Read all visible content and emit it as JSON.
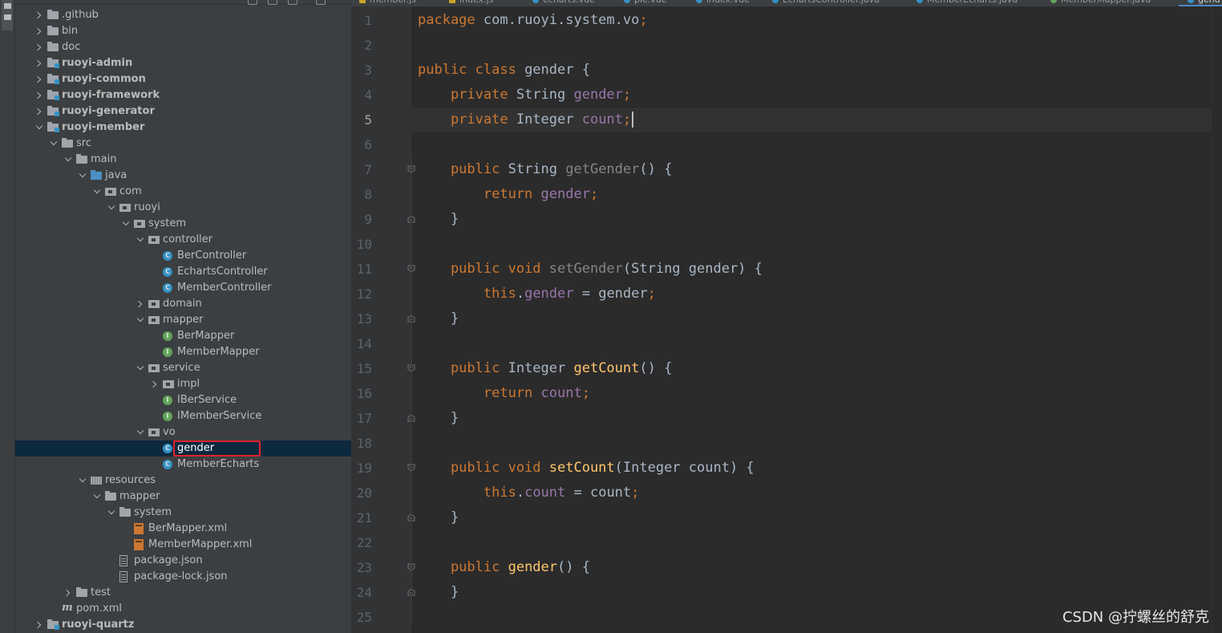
{
  "tree": [
    {
      "label": ".github",
      "depth": 1,
      "icon": "folder",
      "arrow": "collapsed",
      "bold": false
    },
    {
      "label": "bin",
      "depth": 1,
      "icon": "folder",
      "arrow": "collapsed",
      "bold": false
    },
    {
      "label": "doc",
      "depth": 1,
      "icon": "folder",
      "arrow": "collapsed",
      "bold": false
    },
    {
      "label": "ruoyi-admin",
      "depth": 1,
      "icon": "module",
      "arrow": "collapsed",
      "bold": true
    },
    {
      "label": "ruoyi-common",
      "depth": 1,
      "icon": "module",
      "arrow": "collapsed",
      "bold": true
    },
    {
      "label": "ruoyi-framework",
      "depth": 1,
      "icon": "module",
      "arrow": "collapsed",
      "bold": true
    },
    {
      "label": "ruoyi-generator",
      "depth": 1,
      "icon": "module",
      "arrow": "collapsed",
      "bold": true
    },
    {
      "label": "ruoyi-member",
      "depth": 1,
      "icon": "module",
      "arrow": "expanded",
      "bold": true
    },
    {
      "label": "src",
      "depth": 2,
      "icon": "folder",
      "arrow": "expanded",
      "bold": false
    },
    {
      "label": "main",
      "depth": 3,
      "icon": "folder",
      "arrow": "expanded",
      "bold": false
    },
    {
      "label": "java",
      "depth": 4,
      "icon": "srcfolder",
      "arrow": "expanded",
      "bold": false
    },
    {
      "label": "com",
      "depth": 5,
      "icon": "package",
      "arrow": "expanded",
      "bold": false
    },
    {
      "label": "ruoyi",
      "depth": 6,
      "icon": "package",
      "arrow": "expanded",
      "bold": false
    },
    {
      "label": "system",
      "depth": 7,
      "icon": "package",
      "arrow": "expanded",
      "bold": false
    },
    {
      "label": "controller",
      "depth": 8,
      "icon": "package",
      "arrow": "expanded",
      "bold": false
    },
    {
      "label": "BerController",
      "depth": 9,
      "icon": "class",
      "arrow": "none",
      "bold": false
    },
    {
      "label": "EchartsController",
      "depth": 9,
      "icon": "class",
      "arrow": "none",
      "bold": false
    },
    {
      "label": "MemberController",
      "depth": 9,
      "icon": "class",
      "arrow": "none",
      "bold": false
    },
    {
      "label": "domain",
      "depth": 8,
      "icon": "package",
      "arrow": "collapsed",
      "bold": false
    },
    {
      "label": "mapper",
      "depth": 8,
      "icon": "package",
      "arrow": "expanded",
      "bold": false
    },
    {
      "label": "BerMapper",
      "depth": 9,
      "icon": "iface",
      "arrow": "none",
      "bold": false
    },
    {
      "label": "MemberMapper",
      "depth": 9,
      "icon": "iface",
      "arrow": "none",
      "bold": false
    },
    {
      "label": "service",
      "depth": 8,
      "icon": "package",
      "arrow": "expanded",
      "bold": false
    },
    {
      "label": "impl",
      "depth": 9,
      "icon": "package",
      "arrow": "collapsed",
      "bold": false
    },
    {
      "label": "IBerService",
      "depth": 9,
      "icon": "iface",
      "arrow": "none",
      "bold": false
    },
    {
      "label": "IMemberService",
      "depth": 9,
      "icon": "iface",
      "arrow": "none",
      "bold": false
    },
    {
      "label": "vo",
      "depth": 8,
      "icon": "package",
      "arrow": "expanded",
      "bold": false
    },
    {
      "label": "gender",
      "depth": 9,
      "icon": "class",
      "arrow": "none",
      "bold": false,
      "selected": true
    },
    {
      "label": "MemberEcharts",
      "depth": 9,
      "icon": "class",
      "arrow": "none",
      "bold": false
    },
    {
      "label": "resources",
      "depth": 4,
      "icon": "resfolder",
      "arrow": "expanded",
      "bold": false
    },
    {
      "label": "mapper",
      "depth": 5,
      "icon": "folder",
      "arrow": "expanded",
      "bold": false
    },
    {
      "label": "system",
      "depth": 6,
      "icon": "folder",
      "arrow": "expanded",
      "bold": false
    },
    {
      "label": "BerMapper.xml",
      "depth": 7,
      "icon": "xml",
      "arrow": "none",
      "bold": false
    },
    {
      "label": "MemberMapper.xml",
      "depth": 7,
      "icon": "xml",
      "arrow": "none",
      "bold": false
    },
    {
      "label": "package.json",
      "depth": 6,
      "icon": "json",
      "arrow": "none",
      "bold": false
    },
    {
      "label": "package-lock.json",
      "depth": 6,
      "icon": "json",
      "arrow": "none",
      "bold": false
    },
    {
      "label": "test",
      "depth": 3,
      "icon": "folder",
      "arrow": "collapsed",
      "bold": false
    },
    {
      "label": "pom.xml",
      "depth": 2,
      "icon": "maven",
      "arrow": "none",
      "bold": false
    },
    {
      "label": "ruoyi-quartz",
      "depth": 1,
      "icon": "module",
      "arrow": "collapsed",
      "bold": true
    }
  ],
  "editor_tabs": [
    {
      "label": "member.js",
      "icon": "js",
      "active": false
    },
    {
      "label": "index.js",
      "icon": "js",
      "active": false
    },
    {
      "label": "echarts.vue",
      "icon": "class",
      "active": false
    },
    {
      "label": "pie.vue",
      "icon": "class",
      "active": false
    },
    {
      "label": "index.vue",
      "icon": "class",
      "active": false
    },
    {
      "label": "EchartsController.java",
      "icon": "class",
      "active": false
    },
    {
      "label": "MemberEcharts.java",
      "icon": "class",
      "active": false
    },
    {
      "label": "MemberMapper.java",
      "icon": "i",
      "active": false
    },
    {
      "label": "gend",
      "icon": "class",
      "active": true
    }
  ],
  "current_line": 5,
  "code_lines": [
    [
      {
        "t": "package ",
        "c": "kw"
      },
      {
        "t": "com.ruoyi.system.vo",
        "c": ""
      },
      {
        "t": ";",
        "c": "kw"
      }
    ],
    [],
    [
      {
        "t": "public class ",
        "c": "kw"
      },
      {
        "t": "gender {",
        "c": ""
      }
    ],
    [
      {
        "t": "    private ",
        "c": "kw"
      },
      {
        "t": "String ",
        "c": ""
      },
      {
        "t": "gender",
        "c": "field"
      },
      {
        "t": ";",
        "c": "kw"
      }
    ],
    [
      {
        "t": "    private ",
        "c": "kw"
      },
      {
        "t": "Integer ",
        "c": ""
      },
      {
        "t": "count",
        "c": "field"
      },
      {
        "t": ";",
        "c": "kw"
      }
    ],
    [],
    [
      {
        "t": "    public ",
        "c": "kw"
      },
      {
        "t": "String ",
        "c": ""
      },
      {
        "t": "getGender",
        "c": "munused"
      },
      {
        "t": "() {",
        "c": ""
      }
    ],
    [
      {
        "t": "        return ",
        "c": "kw"
      },
      {
        "t": "gender",
        "c": "field"
      },
      {
        "t": ";",
        "c": "kw"
      }
    ],
    [
      {
        "t": "    }",
        "c": ""
      }
    ],
    [],
    [
      {
        "t": "    public void ",
        "c": "kw"
      },
      {
        "t": "setGender",
        "c": "munused"
      },
      {
        "t": "(String gender) {",
        "c": ""
      }
    ],
    [
      {
        "t": "        this",
        "c": "kw"
      },
      {
        "t": ".",
        "c": ""
      },
      {
        "t": "gender",
        "c": "field"
      },
      {
        "t": " = gender",
        "c": ""
      },
      {
        "t": ";",
        "c": "kw"
      }
    ],
    [
      {
        "t": "    }",
        "c": ""
      }
    ],
    [],
    [
      {
        "t": "    public ",
        "c": "kw"
      },
      {
        "t": "Integer ",
        "c": ""
      },
      {
        "t": "getCount",
        "c": "mdecl"
      },
      {
        "t": "() {",
        "c": ""
      }
    ],
    [
      {
        "t": "        return ",
        "c": "kw"
      },
      {
        "t": "count",
        "c": "field"
      },
      {
        "t": ";",
        "c": "kw"
      }
    ],
    [
      {
        "t": "    }",
        "c": ""
      }
    ],
    [],
    [
      {
        "t": "    public void ",
        "c": "kw"
      },
      {
        "t": "setCount",
        "c": "mdecl"
      },
      {
        "t": "(Integer count) {",
        "c": ""
      }
    ],
    [
      {
        "t": "        this",
        "c": "kw"
      },
      {
        "t": ".",
        "c": ""
      },
      {
        "t": "count",
        "c": "field"
      },
      {
        "t": " = count",
        "c": ""
      },
      {
        "t": ";",
        "c": "kw"
      }
    ],
    [
      {
        "t": "    }",
        "c": ""
      }
    ],
    [],
    [
      {
        "t": "    public ",
        "c": "kw"
      },
      {
        "t": "gender",
        "c": "mdecl"
      },
      {
        "t": "() {",
        "c": ""
      }
    ],
    [
      {
        "t": "    }",
        "c": ""
      }
    ],
    []
  ],
  "fold_markers": [
    {
      "line": 7,
      "kind": "open"
    },
    {
      "line": 9,
      "kind": "close"
    },
    {
      "line": 11,
      "kind": "open"
    },
    {
      "line": 13,
      "kind": "close"
    },
    {
      "line": 15,
      "kind": "open"
    },
    {
      "line": 17,
      "kind": "close"
    },
    {
      "line": 19,
      "kind": "open"
    },
    {
      "line": 21,
      "kind": "close"
    },
    {
      "line": 23,
      "kind": "open"
    },
    {
      "line": 24,
      "kind": "close"
    }
  ],
  "watermark": "CSDN @拧螺丝的舒克",
  "colors": {
    "keyword": "#cc7832",
    "field": "#9876aa",
    "method_decl": "#ffc66d",
    "unused_method": "#848488",
    "default_text": "#a9b7c6",
    "selection": "#0d293e",
    "highlight_box": "#e0222c"
  }
}
